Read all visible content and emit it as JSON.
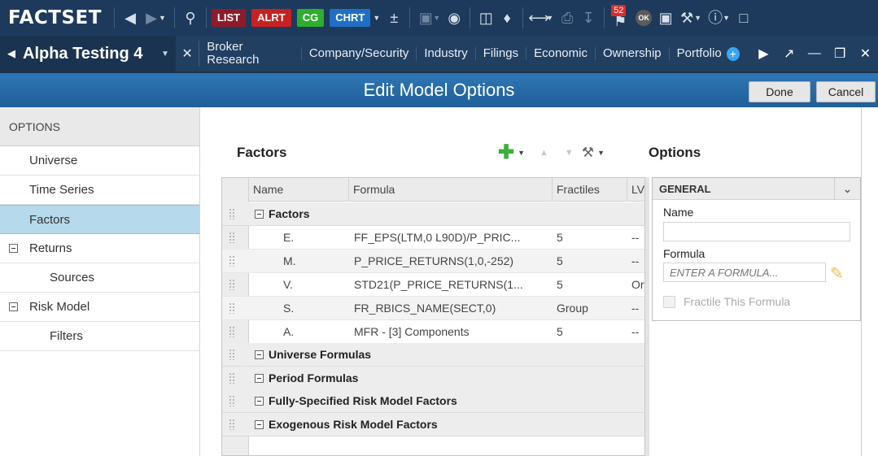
{
  "app": {
    "logo": "FACTSET",
    "toolbar_buttons": [
      {
        "label": "LIST",
        "color": "#8e1b2b"
      },
      {
        "label": "ALRT",
        "color": "#c92121"
      },
      {
        "label": "CG",
        "color": "#2eae2e"
      },
      {
        "label": "CHRT",
        "color": "#1f6fc6"
      }
    ],
    "notification_count": "52",
    "status_badge": "OK"
  },
  "tabs": {
    "document_title": "Alpha Testing 4",
    "items": [
      "Broker Research",
      "Company/Security",
      "Industry",
      "Filings",
      "Economic",
      "Ownership",
      "Portfolio"
    ]
  },
  "dialog": {
    "title": "Edit Model Options",
    "done_label": "Done",
    "cancel_label": "Cancel"
  },
  "sidebar": {
    "header": "OPTIONS",
    "items": [
      {
        "label": "Universe"
      },
      {
        "label": "Time Series"
      },
      {
        "label": "Factors"
      },
      {
        "label": "Returns"
      },
      {
        "label": "Sources"
      },
      {
        "label": "Risk Model"
      },
      {
        "label": "Filters"
      }
    ]
  },
  "factors": {
    "heading": "Factors",
    "columns": [
      "Name",
      "Formula",
      "Fractiles",
      "LV"
    ],
    "group_factors": "Factors",
    "rows": [
      {
        "name": "E.",
        "formula": "FF_EPS(LTM,0 L90D)/P_PRIC...",
        "fractiles": "5",
        "lv": "--"
      },
      {
        "name": "M.",
        "formula": "P_PRICE_RETURNS(1,0,-252)",
        "fractiles": "5",
        "lv": "--"
      },
      {
        "name": "V.",
        "formula": "STD21(P_PRICE_RETURNS(1...",
        "fractiles": "5",
        "lv": "Or"
      },
      {
        "name": "S.",
        "formula": "FR_RBICS_NAME(SECT,0)",
        "fractiles": "Group",
        "lv": "--"
      },
      {
        "name": "A.",
        "formula": "MFR - [3] Components",
        "fractiles": "5",
        "lv": "--"
      }
    ],
    "groups": [
      "Universe Formulas",
      "Period Formulas",
      "Fully-Specified Risk Model Factors",
      "Exogenous Risk Model Factors"
    ]
  },
  "options": {
    "heading": "Options",
    "section": "GENERAL",
    "name_label": "Name",
    "name_value": "",
    "formula_label": "Formula",
    "formula_placeholder": "ENTER A FORMULA...",
    "fractile_label": "Fractile This Formula"
  }
}
